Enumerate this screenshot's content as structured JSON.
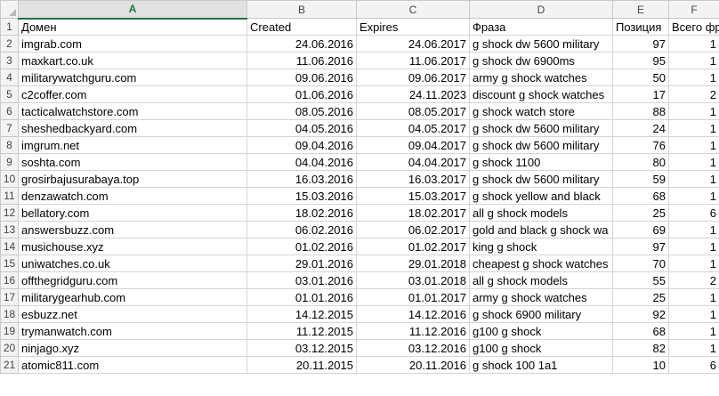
{
  "columns": [
    "A",
    "B",
    "C",
    "D",
    "E",
    "F"
  ],
  "row_numbers": [
    "1",
    "2",
    "3",
    "4",
    "5",
    "6",
    "7",
    "8",
    "9",
    "10",
    "11",
    "12",
    "13",
    "14",
    "15",
    "16",
    "17",
    "18",
    "19",
    "20",
    "21"
  ],
  "header_row": [
    "Домен",
    "Created",
    "Expires",
    "Фраза",
    "Позиция",
    "Всего фраз"
  ],
  "rows": [
    [
      "imgrab.com",
      "24.06.2016",
      "24.06.2017",
      "g shock dw 5600 military",
      "97",
      "1"
    ],
    [
      "maxkart.co.uk",
      "11.06.2016",
      "11.06.2017",
      "g shock dw 6900ms",
      "95",
      "1"
    ],
    [
      "militarywatchguru.com",
      "09.06.2016",
      "09.06.2017",
      "army g shock watches",
      "50",
      "1"
    ],
    [
      "c2coffer.com",
      "01.06.2016",
      "24.11.2023",
      "discount g shock watches",
      "17",
      "2"
    ],
    [
      "tacticalwatchstore.com",
      "08.05.2016",
      "08.05.2017",
      "g shock watch store",
      "88",
      "1"
    ],
    [
      "sheshedbackyard.com",
      "04.05.2016",
      "04.05.2017",
      "g shock dw 5600 military",
      "24",
      "1"
    ],
    [
      "imgrum.net",
      "09.04.2016",
      "09.04.2017",
      "g shock dw 5600 military",
      "76",
      "1"
    ],
    [
      "soshta.com",
      "04.04.2016",
      "04.04.2017",
      "g shock 1100",
      "80",
      "1"
    ],
    [
      "grosirbajusurabaya.top",
      "16.03.2016",
      "16.03.2017",
      "g shock dw 5600 military",
      "59",
      "1"
    ],
    [
      "denzawatch.com",
      "15.03.2016",
      "15.03.2017",
      "g shock yellow and black",
      "68",
      "1"
    ],
    [
      "bellatory.com",
      "18.02.2016",
      "18.02.2017",
      "all g shock models",
      "25",
      "6"
    ],
    [
      "answersbuzz.com",
      "06.02.2016",
      "06.02.2017",
      "gold and black g shock wa",
      "69",
      "1"
    ],
    [
      "musichouse.xyz",
      "01.02.2016",
      "01.02.2017",
      "king g shock",
      "97",
      "1"
    ],
    [
      "uniwatches.co.uk",
      "29.01.2016",
      "29.01.2018",
      "cheapest g shock watches",
      "70",
      "1"
    ],
    [
      "offthegridguru.com",
      "03.01.2016",
      "03.01.2018",
      "all g shock models",
      "55",
      "2"
    ],
    [
      "militarygearhub.com",
      "01.01.2016",
      "01.01.2017",
      "army g shock watches",
      "25",
      "1"
    ],
    [
      "esbuzz.net",
      "14.12.2015",
      "14.12.2016",
      "g shock 6900 military",
      "92",
      "1"
    ],
    [
      "trymanwatch.com",
      "11.12.2015",
      "11.12.2016",
      "g100 g shock",
      "68",
      "1"
    ],
    [
      "ninjago.xyz",
      "03.12.2015",
      "03.12.2016",
      "g100 g shock",
      "82",
      "1"
    ],
    [
      "atomic811.com",
      "20.11.2015",
      "20.11.2016",
      "g shock 100 1a1",
      "10",
      "6"
    ]
  ]
}
